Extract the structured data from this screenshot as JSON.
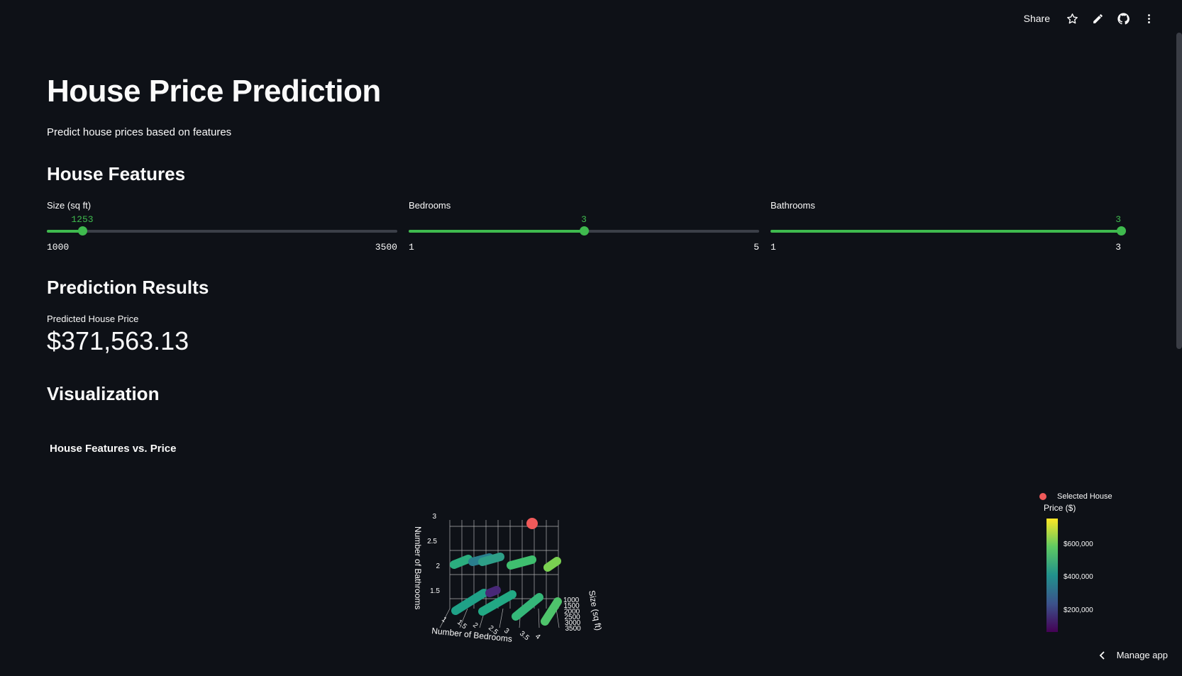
{
  "header": {
    "share_label": "Share",
    "icons": [
      "star-icon",
      "pencil-icon",
      "github-icon",
      "more-icon"
    ]
  },
  "app": {
    "title": "House Price Prediction",
    "subtitle": "Predict house prices based on features"
  },
  "features": {
    "heading": "House Features",
    "sliders": [
      {
        "label": "Size (sq ft)",
        "value": 1253,
        "value_text": "1253",
        "min": 1000,
        "max": 3500,
        "min_text": "1000",
        "max_text": "3500"
      },
      {
        "label": "Bedrooms",
        "value": 3,
        "value_text": "3",
        "min": 1,
        "max": 5,
        "min_text": "1",
        "max_text": "5"
      },
      {
        "label": "Bathrooms",
        "value": 3,
        "value_text": "3",
        "min": 1,
        "max": 3,
        "min_text": "1",
        "max_text": "3"
      }
    ]
  },
  "prediction": {
    "heading": "Prediction Results",
    "metric_label": "Predicted House Price",
    "metric_value": "$371,563.13"
  },
  "visualization": {
    "heading": "Visualization",
    "chart_title": "House Features vs. Price"
  },
  "legend": {
    "selected_label": "Selected House",
    "colorbar_title": "Price ($)",
    "ticks": [
      "$600,000",
      "$400,000",
      "$200,000"
    ]
  },
  "footer": {
    "manage_label": "Manage app"
  },
  "colors": {
    "background": "#0e1117",
    "accent": "#3fba4e",
    "selected": "#ef5a5a"
  },
  "chart_data": {
    "type": "scatter",
    "title": "House Features vs. Price",
    "dimensions": 3,
    "x_axis": {
      "label": "Number of Bedrooms",
      "ticks": [
        "1",
        "1.5",
        "2",
        "2.5",
        "3",
        "3.5",
        "4"
      ]
    },
    "y_axis": {
      "label": "Size (sq ft)",
      "ticks": [
        "1000",
        "1500",
        "2000",
        "2500",
        "3000",
        "3500"
      ]
    },
    "z_axis": {
      "label": "Number of Bathrooms",
      "ticks": [
        "1.5",
        "2",
        "2.5",
        "3"
      ]
    },
    "colorscale": "viridis",
    "color_ticks": [
      "$200,000",
      "$400,000",
      "$600,000"
    ],
    "series": [
      {
        "name": "Selected House",
        "points": [
          {
            "bedrooms": 3,
            "size": 1253,
            "bathrooms": 3
          }
        ]
      }
    ]
  }
}
